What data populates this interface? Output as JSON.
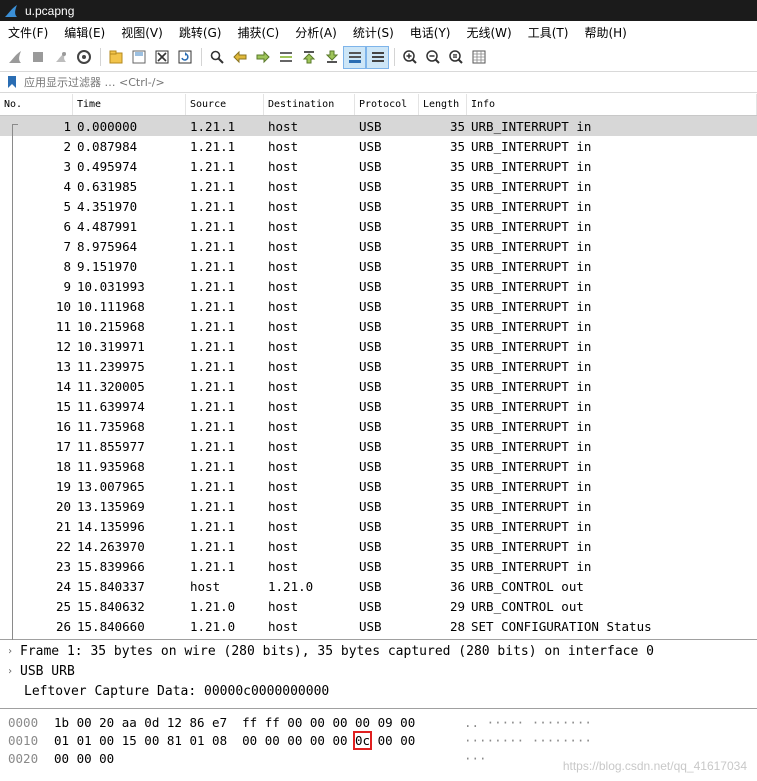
{
  "window": {
    "title": "u.pcapng"
  },
  "menu": [
    "文件(F)",
    "编辑(E)",
    "视图(V)",
    "跳转(G)",
    "捕获(C)",
    "分析(A)",
    "统计(S)",
    "电话(Y)",
    "无线(W)",
    "工具(T)",
    "帮助(H)"
  ],
  "toolbar": {
    "icons": [
      "start-capture-icon",
      "stop-capture-icon",
      "restart-capture-icon",
      "capture-options-icon",
      "open-file-icon",
      "save-file-icon",
      "close-file-icon",
      "reload-file-icon",
      "find-packet-icon",
      "go-back-icon",
      "go-forward-icon",
      "go-to-packet-icon",
      "go-first-icon",
      "go-last-icon",
      "auto-scroll-icon",
      "colorize-icon",
      "zoom-in-icon",
      "zoom-out-icon",
      "zoom-reset-icon",
      "resize-columns-icon"
    ]
  },
  "filter": {
    "placeholder": "应用显示过滤器 … <Ctrl-/>"
  },
  "packet_list": {
    "columns": [
      "No.",
      "Time",
      "Source",
      "Destination",
      "Protocol",
      "Length",
      "Info"
    ],
    "rows": [
      {
        "no": "1",
        "time": "0.000000",
        "src": "1.21.1",
        "dst": "host",
        "proto": "USB",
        "len": "35",
        "info": "URB_INTERRUPT in"
      },
      {
        "no": "2",
        "time": "0.087984",
        "src": "1.21.1",
        "dst": "host",
        "proto": "USB",
        "len": "35",
        "info": "URB_INTERRUPT in"
      },
      {
        "no": "3",
        "time": "0.495974",
        "src": "1.21.1",
        "dst": "host",
        "proto": "USB",
        "len": "35",
        "info": "URB_INTERRUPT in"
      },
      {
        "no": "4",
        "time": "0.631985",
        "src": "1.21.1",
        "dst": "host",
        "proto": "USB",
        "len": "35",
        "info": "URB_INTERRUPT in"
      },
      {
        "no": "5",
        "time": "4.351970",
        "src": "1.21.1",
        "dst": "host",
        "proto": "USB",
        "len": "35",
        "info": "URB_INTERRUPT in"
      },
      {
        "no": "6",
        "time": "4.487991",
        "src": "1.21.1",
        "dst": "host",
        "proto": "USB",
        "len": "35",
        "info": "URB_INTERRUPT in"
      },
      {
        "no": "7",
        "time": "8.975964",
        "src": "1.21.1",
        "dst": "host",
        "proto": "USB",
        "len": "35",
        "info": "URB_INTERRUPT in"
      },
      {
        "no": "8",
        "time": "9.151970",
        "src": "1.21.1",
        "dst": "host",
        "proto": "USB",
        "len": "35",
        "info": "URB_INTERRUPT in"
      },
      {
        "no": "9",
        "time": "10.031993",
        "src": "1.21.1",
        "dst": "host",
        "proto": "USB",
        "len": "35",
        "info": "URB_INTERRUPT in"
      },
      {
        "no": "10",
        "time": "10.111968",
        "src": "1.21.1",
        "dst": "host",
        "proto": "USB",
        "len": "35",
        "info": "URB_INTERRUPT in"
      },
      {
        "no": "11",
        "time": "10.215968",
        "src": "1.21.1",
        "dst": "host",
        "proto": "USB",
        "len": "35",
        "info": "URB_INTERRUPT in"
      },
      {
        "no": "12",
        "time": "10.319971",
        "src": "1.21.1",
        "dst": "host",
        "proto": "USB",
        "len": "35",
        "info": "URB_INTERRUPT in"
      },
      {
        "no": "13",
        "time": "11.239975",
        "src": "1.21.1",
        "dst": "host",
        "proto": "USB",
        "len": "35",
        "info": "URB_INTERRUPT in"
      },
      {
        "no": "14",
        "time": "11.320005",
        "src": "1.21.1",
        "dst": "host",
        "proto": "USB",
        "len": "35",
        "info": "URB_INTERRUPT in"
      },
      {
        "no": "15",
        "time": "11.639974",
        "src": "1.21.1",
        "dst": "host",
        "proto": "USB",
        "len": "35",
        "info": "URB_INTERRUPT in"
      },
      {
        "no": "16",
        "time": "11.735968",
        "src": "1.21.1",
        "dst": "host",
        "proto": "USB",
        "len": "35",
        "info": "URB_INTERRUPT in"
      },
      {
        "no": "17",
        "time": "11.855977",
        "src": "1.21.1",
        "dst": "host",
        "proto": "USB",
        "len": "35",
        "info": "URB_INTERRUPT in"
      },
      {
        "no": "18",
        "time": "11.935968",
        "src": "1.21.1",
        "dst": "host",
        "proto": "USB",
        "len": "35",
        "info": "URB_INTERRUPT in"
      },
      {
        "no": "19",
        "time": "13.007965",
        "src": "1.21.1",
        "dst": "host",
        "proto": "USB",
        "len": "35",
        "info": "URB_INTERRUPT in"
      },
      {
        "no": "20",
        "time": "13.135969",
        "src": "1.21.1",
        "dst": "host",
        "proto": "USB",
        "len": "35",
        "info": "URB_INTERRUPT in"
      },
      {
        "no": "21",
        "time": "14.135996",
        "src": "1.21.1",
        "dst": "host",
        "proto": "USB",
        "len": "35",
        "info": "URB_INTERRUPT in"
      },
      {
        "no": "22",
        "time": "14.263970",
        "src": "1.21.1",
        "dst": "host",
        "proto": "USB",
        "len": "35",
        "info": "URB_INTERRUPT in"
      },
      {
        "no": "23",
        "time": "15.839966",
        "src": "1.21.1",
        "dst": "host",
        "proto": "USB",
        "len": "35",
        "info": "URB_INTERRUPT in"
      },
      {
        "no": "24",
        "time": "15.840337",
        "src": "host",
        "dst": "1.21.0",
        "proto": "USB",
        "len": "36",
        "info": "URB_CONTROL out"
      },
      {
        "no": "25",
        "time": "15.840632",
        "src": "1.21.0",
        "dst": "host",
        "proto": "USB",
        "len": "29",
        "info": "URB_CONTROL out"
      },
      {
        "no": "26",
        "time": "15.840660",
        "src": "1.21.0",
        "dst": "host",
        "proto": "USB",
        "len": "28",
        "info": "SET CONFIGURATION Status"
      }
    ]
  },
  "details": [
    {
      "text": "Frame 1: 35 bytes on wire (280 bits), 35 bytes captured (280 bits) on interface 0",
      "expandable": true
    },
    {
      "text": "USB URB",
      "expandable": true
    },
    {
      "text": "Leftover Capture Data: 00000c0000000000",
      "expandable": false
    }
  ],
  "bytes": {
    "rows": [
      {
        "offset": "0000",
        "hex_before": "1b 00 20 aa 0d 12 86 e7  ff ff 00 00 00 00 09 00",
        "hex_hl": "",
        "hex_after": "",
        "ascii": ".. ····· ········"
      },
      {
        "offset": "0010",
        "hex_before": "01 01 00 15 00 81 01 08  00 00 00 00 00 ",
        "hex_hl": "0c",
        "hex_after": " 00 00",
        "ascii": "········ ········"
      },
      {
        "offset": "0020",
        "hex_before": "00 00 00",
        "hex_hl": "",
        "hex_after": "",
        "ascii": "···"
      }
    ]
  },
  "watermark": "https://blog.csdn.net/qq_41617034",
  "colors": {
    "titlebar": "#1b1b1b",
    "selected_row": "#d7d7d7",
    "highlight_box": "#e02020"
  }
}
